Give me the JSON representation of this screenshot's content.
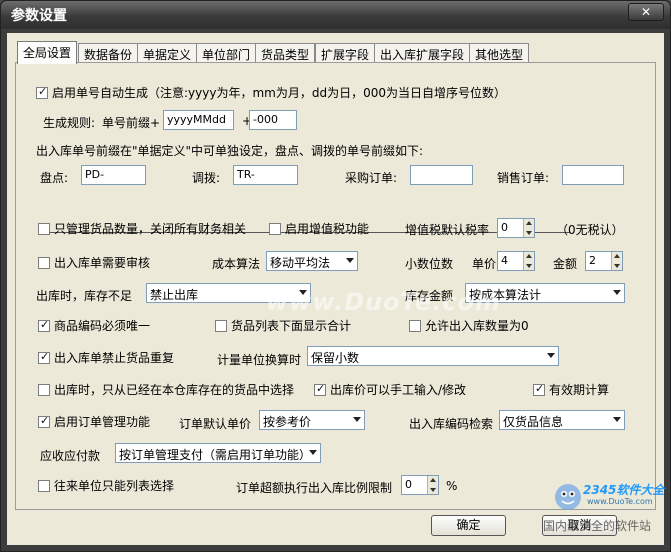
{
  "window": {
    "title": "参数设置",
    "close_glyph": "✕"
  },
  "tabs": [
    "全局设置",
    "数据备份",
    "单据定义",
    "单位部门",
    "货品类型",
    "扩展字段",
    "出入库扩展字段",
    "其他选型"
  ],
  "form": {
    "auto_gen": {
      "label": "启用单号自动生成（注意:yyyy为年，mm为月，dd为日，000为当日自增序号位数）",
      "checked": true
    },
    "rule_label": "生成规则:",
    "prefix_label": "单号前缀+",
    "prefix_value": "yyyyMMdd",
    "plus": "+",
    "seq_value": "-000",
    "note": "出入库单号前缀在\"单据定义\"中可单独设定，盘点、调拨的单号前缀如下:",
    "stocktake_label": "盘点:",
    "stocktake_value": "PD-",
    "transfer_label": "调拨:",
    "transfer_value": "TR-",
    "purchase_label": "采购订单:",
    "purchase_value": "",
    "sales_label": "销售订单:",
    "sales_value": "",
    "only_qty": {
      "label": "只管理货品数量，关闭所有财务相关",
      "checked": false
    },
    "vat_enable": {
      "label": "启用增值税功能",
      "checked": false
    },
    "vat_rate_label": "增值税默认税率",
    "vat_rate_value": "0",
    "vat_rate_note": "（0无税认）",
    "need_audit": {
      "label": "出入库单需要审核",
      "checked": false
    },
    "cost_method_label": "成本算法",
    "cost_method_value": "移动平均法",
    "decimal_label": "小数位数",
    "unit_price_label": "单价",
    "unit_price_value": "4",
    "amount_label": "金额",
    "amount_value": "2",
    "out_insufficient_label": "出库时，库存不足",
    "out_insufficient_value": "禁止出库",
    "stock_amount_label": "库存金额",
    "stock_amount_value": "按成本算法计",
    "code_unique": {
      "label": "商品编码必须唯一",
      "checked": true
    },
    "show_total": {
      "label": "货品列表下面显示合计",
      "checked": false
    },
    "allow_zero": {
      "label": "允许出入库数量为0",
      "checked": false
    },
    "no_dup": {
      "label": "出入库单禁止货品重复",
      "checked": true
    },
    "unit_convert_label": "计量单位换算时",
    "unit_convert_value": "保留小数",
    "only_in_stock": {
      "label": "出库时，只从已经在本仓库存在的货品中选择",
      "checked": false
    },
    "manual_price": {
      "label": "出库价可以手工输入/修改",
      "checked": true
    },
    "expiry": {
      "label": "有效期计算",
      "checked": true
    },
    "order_mgmt": {
      "label": "启用订单管理功能",
      "checked": true
    },
    "order_price_label": "订单默认单价",
    "order_price_value": "按参考价",
    "code_search_label": "出入库编码检索",
    "code_search_value": "仅货品信息",
    "payable_label": "应收应付款",
    "payable_value": "按订单管理支付（需启用订单功能）",
    "partner_only": {
      "label": "往来单位只能列表选择",
      "checked": false
    },
    "over_ratio_label": "订单超额执行出入库比例限制",
    "over_ratio_value": "0",
    "percent": "%"
  },
  "buttons": {
    "ok": "确定",
    "cancel": "取消"
  },
  "watermarks": {
    "center": "www.DuoTe.com",
    "brand": "2345软件大全",
    "url": "www.DuoTe.com",
    "slogan": "国内最安全的软件站"
  }
}
